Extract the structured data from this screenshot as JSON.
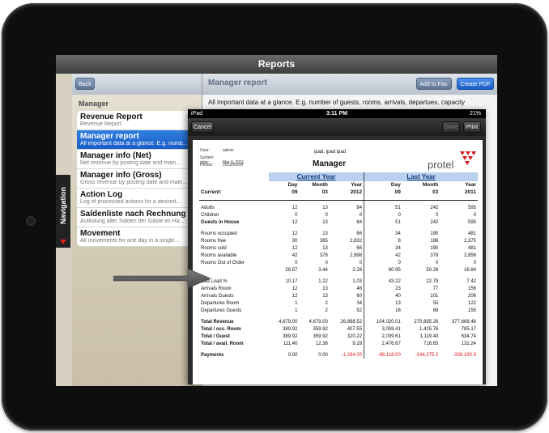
{
  "app": {
    "title": "Reports",
    "left": {
      "back_label": "Back",
      "heading": "Manager",
      "items": [
        {
          "title": "Revenue Report",
          "sub": "Revenue Report"
        },
        {
          "title": "Manager report",
          "sub": "All important data at a glance. E.g. numb..."
        },
        {
          "title": "Manager info (Net)",
          "sub": "Net revenue by posting date and main..."
        },
        {
          "title": "Manager info (Gross)",
          "sub": "Gross revenue by posting date and main..."
        },
        {
          "title": "Action Log",
          "sub": "Log of processed actions for a desired..."
        },
        {
          "title": "Saldenliste nach Rechnung",
          "sub": "Auflistung aller Salden der Gäste im Ha..."
        },
        {
          "title": "Movement",
          "sub": "All movements for one day in a single..."
        }
      ]
    },
    "right": {
      "title": "Manager report",
      "add_fav_label": "Add to Fav.",
      "create_pdf_label": "Create PDF",
      "description": "All important data at a glance. E.g. number of guests, rooms, arrivals, departues, capacity"
    },
    "navigation_label": "Navigation"
  },
  "preview": {
    "status": {
      "carrier": "iPad",
      "time": "3:11 PM",
      "battery": "21%"
    },
    "cancel_label": "Cancel",
    "done_label": "Done",
    "print_label": "Print",
    "meta": [
      {
        "key": "User:",
        "value": "admin"
      },
      {
        "key": "System date:",
        "value": "Mar 9, 2011"
      },
      {
        "key": "Period:",
        "value": "2012/03/09"
      }
    ],
    "user_line": "ipad, ipad ipad",
    "report_title": "Manager",
    "logo_text": "protel",
    "current_year": "Current Year",
    "last_year": "Last Year",
    "col_headers": [
      "Day",
      "Month",
      "Year",
      "Day",
      "Month",
      "Year"
    ],
    "current_label": "Current:",
    "current_values": [
      "09",
      "03",
      "2012",
      "09",
      "03",
      "2011"
    ],
    "rows": [
      {
        "label": "Adults",
        "v": [
          "12",
          "13",
          "84",
          "51",
          "242",
          "595"
        ]
      },
      {
        "label": "Children",
        "v": [
          "0",
          "0",
          "0",
          "0",
          "0",
          "0"
        ]
      },
      {
        "label": "Guests in House",
        "v": [
          "12",
          "13",
          "84",
          "51",
          "242",
          "595"
        ]
      },
      {
        "label": "Rooms occupied",
        "v": [
          "12",
          "13",
          "66",
          "34",
          "190",
          "481"
        ]
      },
      {
        "label": "Rooms free",
        "v": [
          "30",
          "365",
          "2,832",
          "8",
          "188",
          "2,375"
        ]
      },
      {
        "label": "Rooms sold",
        "v": [
          "12",
          "13",
          "66",
          "34",
          "190",
          "481"
        ]
      },
      {
        "label": "Rooms available",
        "v": [
          "42",
          "378",
          "2,898",
          "42",
          "378",
          "2,856"
        ]
      },
      {
        "label": "Rooms Out of Order",
        "v": [
          "0",
          "0",
          "0",
          "0",
          "0",
          "0"
        ]
      },
      {
        "label": "",
        "v": [
          "28.57",
          "3.44",
          "2.28",
          "80.95",
          "50.26",
          "16.84"
        ]
      },
      {
        "label": "Bed Load %",
        "v": [
          "10.17",
          "1.22",
          "1.03",
          "43.22",
          "22.79",
          "7.42"
        ]
      },
      {
        "label": "Arrivals Room",
        "v": [
          "12",
          "13",
          "46",
          "23",
          "77",
          "156"
        ]
      },
      {
        "label": "Arrivals Guests",
        "v": [
          "12",
          "13",
          "60",
          "40",
          "101",
          "206"
        ]
      },
      {
        "label": "Departures Room",
        "v": [
          "1",
          "2",
          "34",
          "13",
          "55",
          "122"
        ]
      },
      {
        "label": "Departures Guests",
        "v": [
          "1",
          "2",
          "52",
          "16",
          "68",
          "155"
        ]
      },
      {
        "label": "Total Revenue",
        "v": [
          "4,679.00",
          "4,679.00",
          "26,898.52",
          "104,020.01",
          "270,895.26",
          "377,668.46"
        ]
      },
      {
        "label": "Total / occ. Room",
        "v": [
          "389.92",
          "359.92",
          "407.55",
          "3,059.41",
          "1,425.76",
          "785.17"
        ]
      },
      {
        "label": "Total / Guest",
        "v": [
          "389.92",
          "359.92",
          "320.22",
          "2,039.61",
          "1,119.40",
          "634.74"
        ]
      },
      {
        "label": "Total / avail. Room",
        "v": [
          "111.40",
          "12.38",
          "9.28",
          "2,476.67",
          "716.65",
          "132.24"
        ]
      },
      {
        "label": "Payments",
        "v": [
          "0.00",
          "0.00",
          "-1,294.00",
          "-96,118.00",
          "-244,275.2",
          "-339,190.9"
        ]
      }
    ]
  },
  "colors": {
    "accent_blue": "#2f7fe0",
    "band_blue": "#b9d0ee",
    "negative_red": "#e02020",
    "logo_red": "#d21c1c"
  }
}
